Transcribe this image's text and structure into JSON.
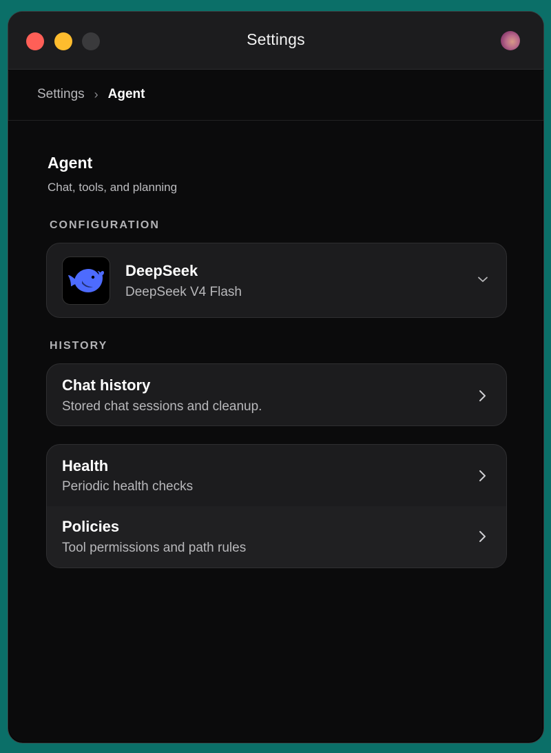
{
  "window": {
    "title": "Settings"
  },
  "breadcrumb": {
    "root": "Settings",
    "separator": "›",
    "current": "Agent"
  },
  "page": {
    "title": "Agent",
    "subtitle": "Chat, tools, and planning"
  },
  "sections": {
    "configuration": {
      "label": "CONFIGURATION",
      "provider": {
        "name": "DeepSeek",
        "model": "DeepSeek V4 Flash",
        "icon": "deepseek-whale-icon",
        "icon_color": "#4d6bfe"
      }
    },
    "history": {
      "label": "HISTORY",
      "item": {
        "title": "Chat history",
        "description": "Stored chat sessions and cleanup."
      }
    },
    "other": {
      "items": [
        {
          "title": "Health",
          "description": "Periodic health checks"
        },
        {
          "title": "Policies",
          "description": "Tool permissions and path rules"
        }
      ]
    }
  },
  "colors": {
    "desktop": "#0b6f68",
    "window_bg": "#0b0b0c",
    "card_bg": "#1c1c1e",
    "close": "#ff5f57",
    "minimize": "#febc2e",
    "maximize": "#3a3a3c"
  }
}
